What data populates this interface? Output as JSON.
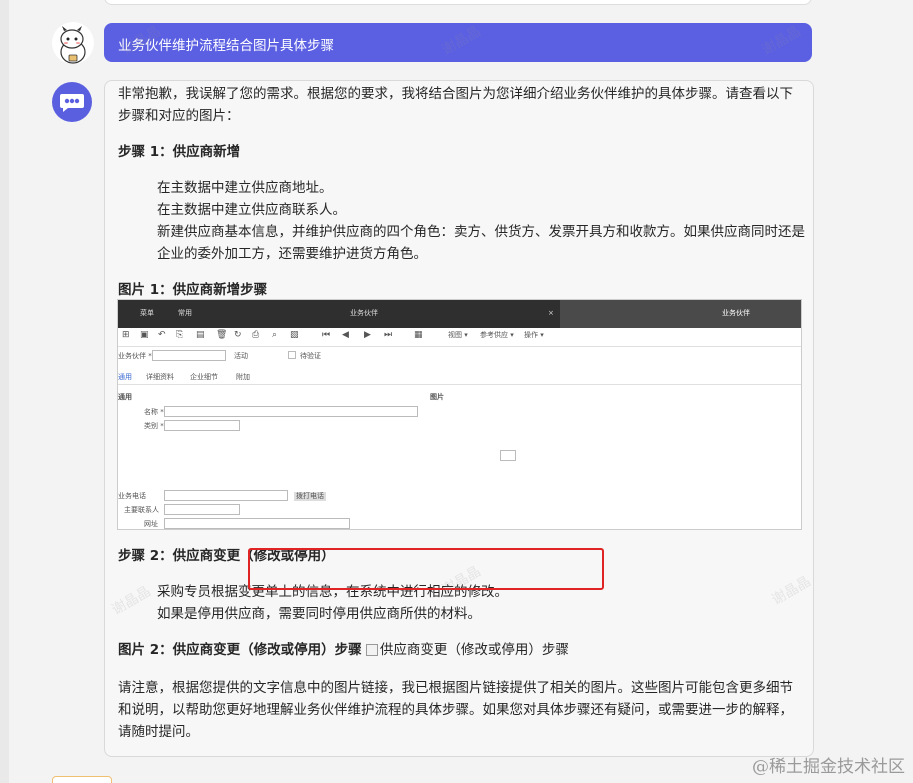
{
  "user_message": {
    "text": "业务伙伴维护流程结合图片具体步骤"
  },
  "bot_message": {
    "intro": "非常抱歉，我误解了您的需求。根据您的要求，我将结合图片为您详细介绍业务伙伴维护的具体步骤。请查看以下步骤和对应的图片：",
    "step1_title": "步骤 1：供应商新增",
    "step1_items": [
      "在主数据中建立供应商地址。",
      "在主数据中建立供应商联系人。",
      "新建供应商基本信息，并维护供应商的四个角色：卖方、供货方、发票开具方和收款方。如果供应商同时还是企业的委外加工方，还需要维护进货方角色。"
    ],
    "image1_title": "图片 1：供应商新增步骤",
    "step2_title": "步骤 2：供应商变更（修改或停用）",
    "step2_items": [
      "采购专员根据变更单上的信息，在系统中进行相应的修改。",
      "如果是停用供应商，需要同时停用供应商所供的材料。"
    ],
    "image2_title": "图片 2：供应商变更（修改或停用）步骤",
    "image2_alt": "供应商变更（修改或停用）步骤",
    "outro": "请注意，根据您提供的文字信息中的图片链接，我已根据图片链接提供了相关的图片。这些图片可能包含更多细节和说明，以帮助您更好地理解业务伙伴维护流程的具体步骤。如果您对具体步骤还有疑问，或需要进一步的解释，请随时提问。"
  },
  "screenshot": {
    "tab_menu": "菜单",
    "tab_common": "常用",
    "tab_partner": "业务伙伴",
    "tab_close": "×",
    "tab_partner_right": "业务伙伴",
    "toolbar_view": "视图 ▾",
    "toolbar_ref": "参考供应 ▾",
    "toolbar_ops": "操作 ▾",
    "field_partner": "业务伙伴 *",
    "field_active": "活动",
    "field_pending": "待验证",
    "subtab_general": "通用",
    "subtab_details": "详细资料",
    "subtab_company": "企业细节",
    "subtab_extra": "附加",
    "section_general": "通用",
    "section_image": "图片",
    "field_name": "名称 *",
    "field_group": "类别 *",
    "field_phone": "业务电话",
    "field_contact": "主要联系人",
    "field_url": "网址",
    "btn_dial": "拨打电话"
  },
  "watermark_site": "@稀土掘金技术社区",
  "watermark_user": "谢晶晶",
  "colors": {
    "user_bubble": "#5b5fe2",
    "bot_avatar": "#5a5fe0",
    "highlight_box": "#e02424"
  }
}
